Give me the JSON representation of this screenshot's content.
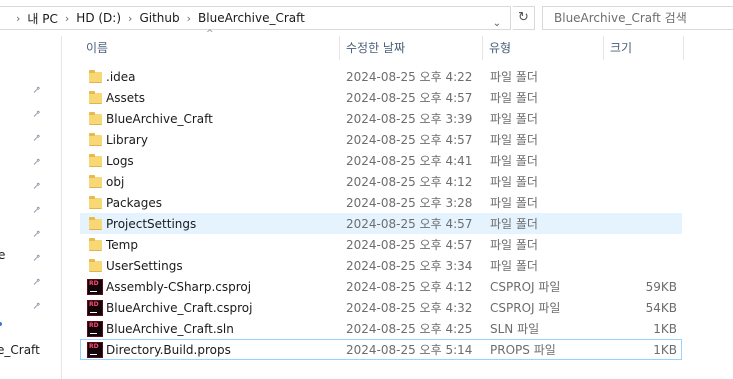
{
  "address": {
    "crumbs": [
      "내 PC",
      "HD (D:)",
      "Github",
      "BlueArchive_Craft"
    ],
    "separator": "›",
    "dropdown_glyph": "⌄",
    "refresh_glyph": "↻"
  },
  "search": {
    "placeholder": "BlueArchive_Craft 검색"
  },
  "nav": {
    "pin_glyph": "📌",
    "pin_count": 10,
    "partial_item_e": "e",
    "partial_item_craft": "e_Craft"
  },
  "columns": {
    "name": "이름",
    "date": "수정한 날짜",
    "type": "유형",
    "size": "크기",
    "sort_glyph": "^"
  },
  "files": [
    {
      "name": ".idea",
      "date": "2024-08-25 오후 4:22",
      "type": "파일 폴더",
      "size": "",
      "icon": "folder-icon"
    },
    {
      "name": "Assets",
      "date": "2024-08-25 오후 4:57",
      "type": "파일 폴더",
      "size": "",
      "icon": "folder-icon"
    },
    {
      "name": "BlueArchive_Craft",
      "date": "2024-08-25 오후 3:39",
      "type": "파일 폴더",
      "size": "",
      "icon": "folder-icon"
    },
    {
      "name": "Library",
      "date": "2024-08-25 오후 4:57",
      "type": "파일 폴더",
      "size": "",
      "icon": "folder-icon"
    },
    {
      "name": "Logs",
      "date": "2024-08-25 오후 4:41",
      "type": "파일 폴더",
      "size": "",
      "icon": "folder-icon"
    },
    {
      "name": "obj",
      "date": "2024-08-25 오후 4:12",
      "type": "파일 폴더",
      "size": "",
      "icon": "folder-icon"
    },
    {
      "name": "Packages",
      "date": "2024-08-25 오후 3:28",
      "type": "파일 폴더",
      "size": "",
      "icon": "folder-icon"
    },
    {
      "name": "ProjectSettings",
      "date": "2024-08-25 오후 4:57",
      "type": "파일 폴더",
      "size": "",
      "icon": "folder-icon",
      "hover": true
    },
    {
      "name": "Temp",
      "date": "2024-08-25 오후 4:57",
      "type": "파일 폴더",
      "size": "",
      "icon": "folder-icon"
    },
    {
      "name": "UserSettings",
      "date": "2024-08-25 오후 3:34",
      "type": "파일 폴더",
      "size": "",
      "icon": "folder-icon"
    },
    {
      "name": "Assembly-CSharp.csproj",
      "date": "2024-08-25 오후 4:12",
      "type": "CSPROJ 파일",
      "size": "59KB",
      "icon": "rider-file-icon"
    },
    {
      "name": "BlueArchive_Craft.csproj",
      "date": "2024-08-25 오후 4:32",
      "type": "CSPROJ 파일",
      "size": "54KB",
      "icon": "rider-file-icon"
    },
    {
      "name": "BlueArchive_Craft.sln",
      "date": "2024-08-25 오후 4:25",
      "type": "SLN 파일",
      "size": "1KB",
      "icon": "rider-file-icon"
    },
    {
      "name": "Directory.Build.props",
      "date": "2024-08-25 오후 5:14",
      "type": "PROPS 파일",
      "size": "1KB",
      "icon": "rider-file-icon",
      "focused": true
    }
  ],
  "rider_icon_text": "RD",
  "colors": {
    "hover_bg": "#e5f3ff",
    "focus_border": "#99d1ff",
    "header_text": "#4c607a",
    "folder_yellow": "#f8d775"
  }
}
